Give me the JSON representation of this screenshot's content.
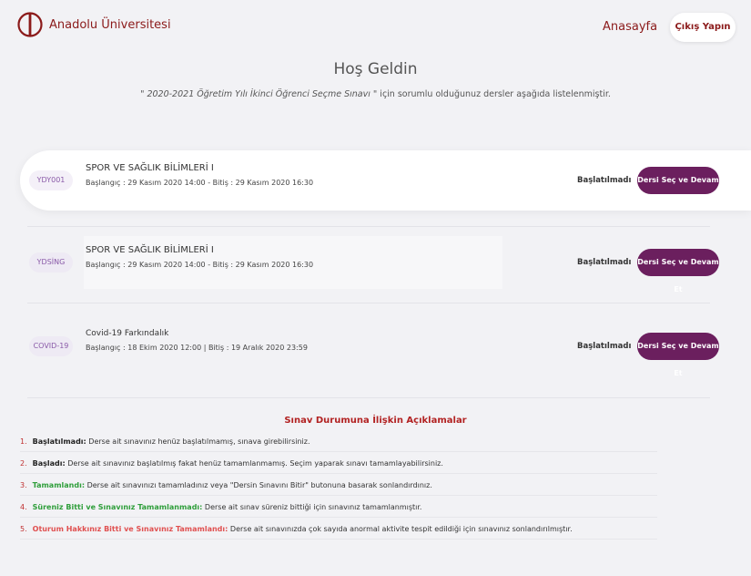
{
  "header": {
    "logo_text": "Anadolu Üniversitesi",
    "home_link": "Anasayfa",
    "logout_button": "Çıkış Yapın"
  },
  "welcome": {
    "title": "Hoş Geldin",
    "subtitle_exam": "\" 2020-2021 Öğretim Yılı İkinci Öğrenci Seçme Sınavı \"",
    "subtitle_rest": " için sorumlu olduğunuz dersler aşağıda listelenmiştir."
  },
  "courses": [
    {
      "code": "YDY001",
      "name": "SPOR VE SAĞLIK BİLİMLERİ I",
      "dates": "Başlangıç : 29 Kasım 2020 14:00 - Bitiş : 29 Kasım 2020 16:30",
      "status": "Başlatılmadı",
      "action": "Dersi Seç ve Devam Et"
    },
    {
      "code": "YDSİNG",
      "name": "SPOR VE SAĞLIK BİLİMLERİ I",
      "dates": "Başlangıç : 29 Kasım 2020 14:00 - Bitiş : 29 Kasım 2020 16:30",
      "status": "Başlatılmadı",
      "action": "Dersi Seç ve Devam Et"
    },
    {
      "code": "COVID-19",
      "name": "Covid-19 Farkındalık",
      "dates": "Başlangıç : 18 Ekim 2020 12:00  |  Bitiş : 19 Aralık 2020 23:59",
      "status": "Başlatılmadı",
      "action": "Dersi Seç ve Devam Et"
    }
  ],
  "explanations": {
    "title": "Sınav Durumuna İlişkin Açıklamalar",
    "items": [
      {
        "num": "1.",
        "term": "Başlatılmadı:",
        "text": " Derse ait sınavınız henüz başlatılmamış, sınava girebilirsiniz."
      },
      {
        "num": "2.",
        "term": "Başladı:",
        "text": " Derse ait sınavınız başlatılmış fakat henüz tamamlanmamış. Seçim yaparak sınavı tamamlayabilirsiniz."
      },
      {
        "num": "3.",
        "term": "Tamamlandı:",
        "text": " Derse ait sınavınızı tamamladınız veya \"Dersin Sınavını Bitir\" butonuna basarak sonlandırdınız."
      },
      {
        "num": "4.",
        "term": "Süreniz Bitti ve Sınavınız Tamamlanmadı:",
        "text": " Derse ait sınav süreniz bittiği için sınavınız tamamlanmıştır."
      },
      {
        "num": "5.",
        "term": "Oturum Hakkınız Bitti ve Sınavınız Tamamlandı:",
        "text": " Derse ait sınavınızda çok sayıda anormal aktivite tespit edildiği için sınavınız sonlandırılmıştır."
      }
    ]
  },
  "colors": {
    "brand": "#8b1a1a",
    "button": "#6b1f5e",
    "green": "#2e9e3a",
    "red": "#e05050"
  }
}
